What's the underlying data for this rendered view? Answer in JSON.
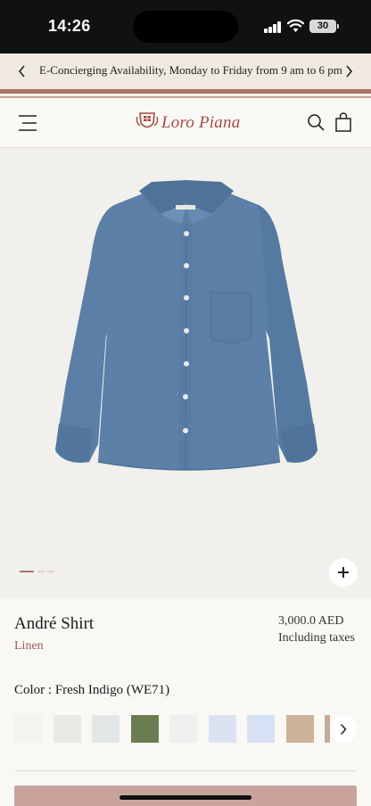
{
  "status_bar": {
    "time": "14:26",
    "battery": "30"
  },
  "announcement": {
    "text": "E-Concierging Availability, Monday to Friday from 9 am to 6 pm",
    "prev_icon": "chevron-left-icon",
    "next_icon": "chevron-right-icon"
  },
  "header": {
    "brand": "Loro Piana",
    "menu_icon": "menu-icon",
    "search_icon": "search-icon",
    "bag_icon": "shopping-bag-icon"
  },
  "gallery": {
    "image_alt": "André Shirt in Fresh Indigo",
    "slide_count": 3,
    "active_slide": 1,
    "zoom_icon": "plus-icon"
  },
  "product": {
    "name": "André Shirt",
    "material": "Linen",
    "price": "3,000.0 AED",
    "tax_note": "Including taxes",
    "color_label": "Color : Fresh Indigo (WE71)"
  },
  "swatches": [
    {
      "color": "#f3f4ef"
    },
    {
      "color": "#ebe9e6"
    },
    {
      "color": "#e3e6e7"
    },
    {
      "color": "#6b7c50"
    },
    {
      "color": "#edf0ee"
    },
    {
      "color": "#dbe3f3"
    },
    {
      "color": "#d6e1f6"
    },
    {
      "color": "#cdb299"
    },
    {
      "color": "#c4ab98"
    }
  ],
  "colors": {
    "accent": "#a24a44",
    "shirt": "#5a7ea6",
    "cta": "#c8a49d"
  }
}
